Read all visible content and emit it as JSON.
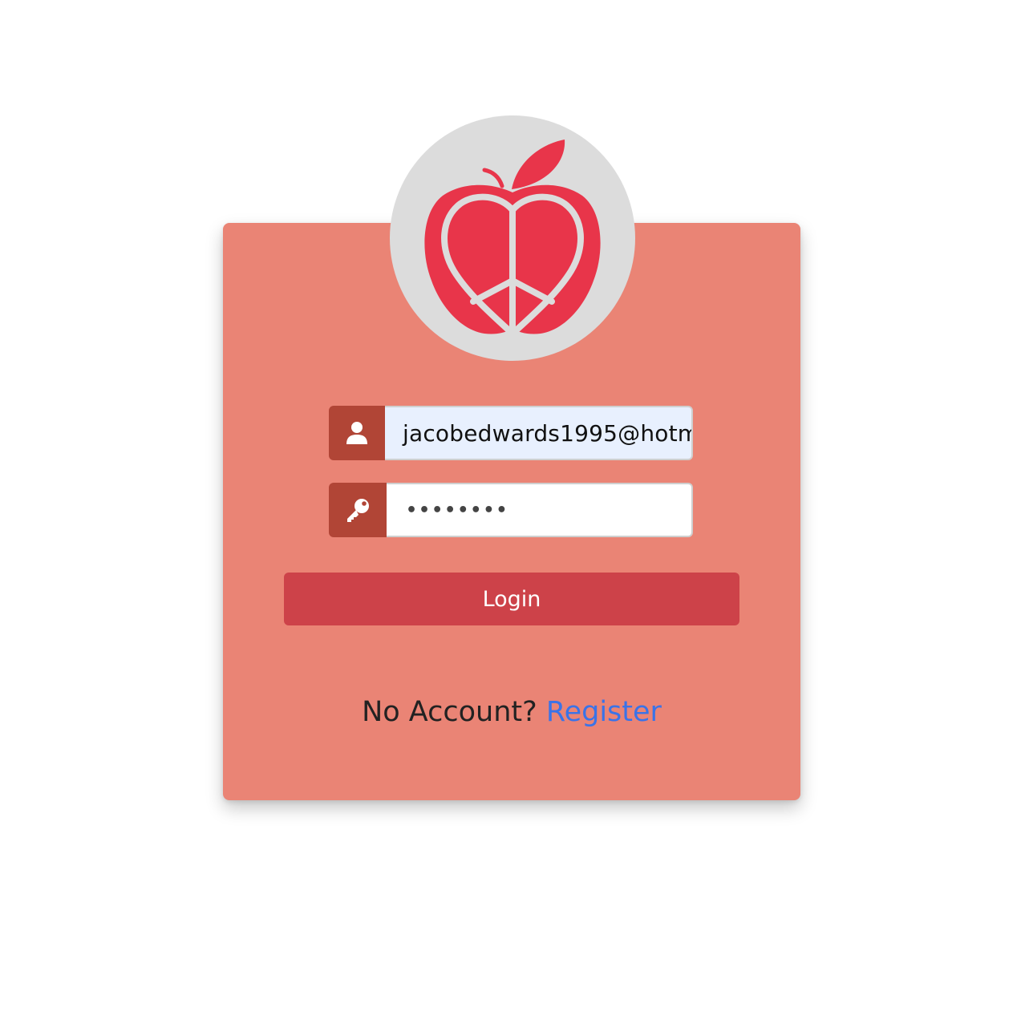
{
  "logo": {
    "icon": "apple-peace-heart-logo",
    "colors": {
      "apple": "#e8354a",
      "circle": "#dcdcdc"
    }
  },
  "form": {
    "email": {
      "icon": "user-icon",
      "value": "jacobedwards1995@hotm"
    },
    "password": {
      "icon": "key-icon",
      "value": "••••••••"
    },
    "login_label": "Login"
  },
  "footer": {
    "prompt": "No Account?",
    "link_label": "Register"
  },
  "colors": {
    "card": "#ea8475",
    "addon": "#b14536",
    "button": "#cd4249",
    "link": "#3a73e8"
  }
}
